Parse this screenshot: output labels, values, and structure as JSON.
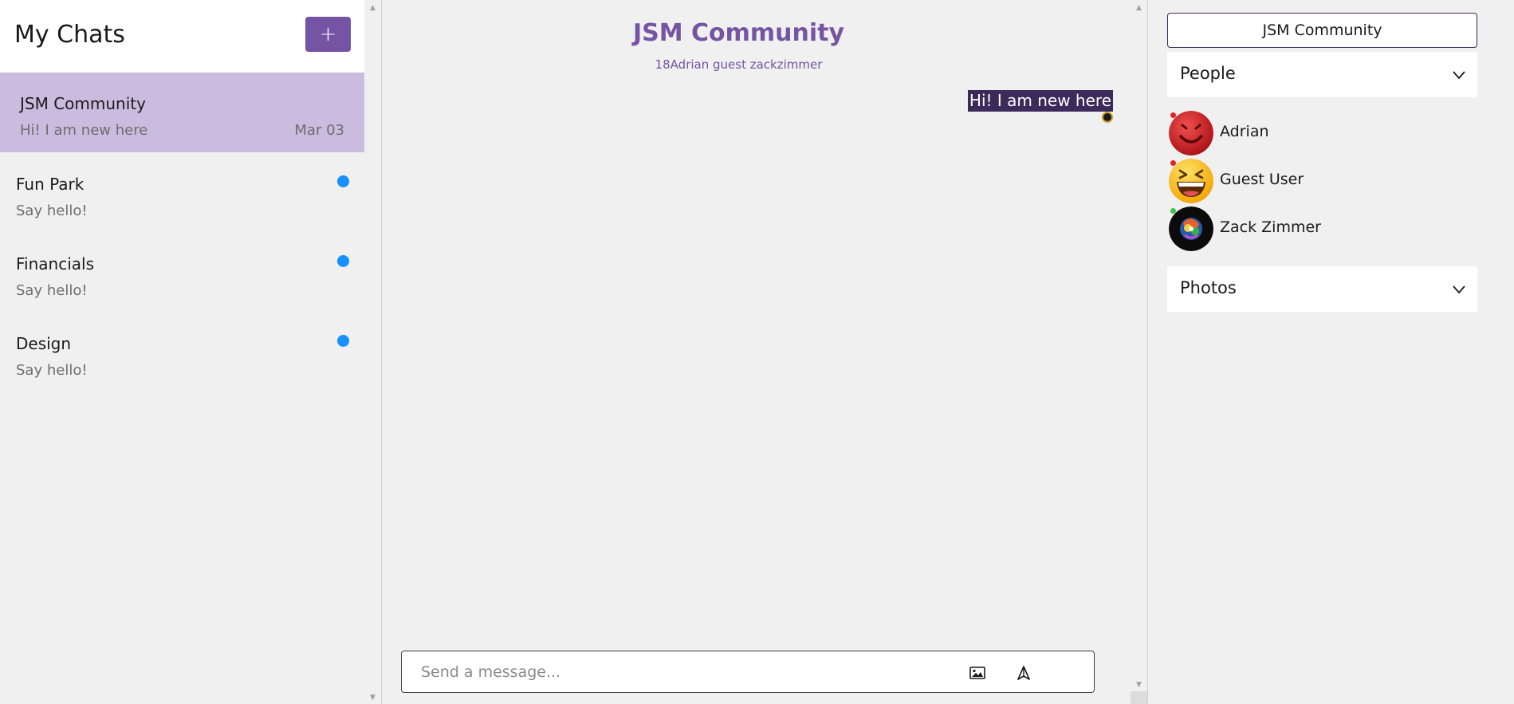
{
  "chat_list": {
    "title": "My Chats",
    "new_chat_label": "+",
    "chats": [
      {
        "title": "JSM Community",
        "preview": "Hi! I am new here",
        "date": "Mar 03",
        "active": true,
        "unread": false
      },
      {
        "title": "Fun Park",
        "preview": "Say hello!",
        "date": "",
        "active": false,
        "unread": true
      },
      {
        "title": "Financials",
        "preview": "Say hello!",
        "date": "",
        "active": false,
        "unread": true
      },
      {
        "title": "Design",
        "preview": "Say hello!",
        "date": "",
        "active": false,
        "unread": true
      }
    ]
  },
  "chat_feed": {
    "title": "JSM Community",
    "subtitle": "18Adrian guest zackzimmer",
    "messages": [
      {
        "text": "Hi! I am new here",
        "mine": true
      }
    ],
    "input": {
      "placeholder": "Send a message...",
      "value": ""
    },
    "icons": {
      "attach": "image-upload-icon",
      "send": "send-icon"
    }
  },
  "chat_settings": {
    "title": "JSM Community",
    "sections": {
      "people": "People",
      "photos": "Photos"
    },
    "people": [
      {
        "name": "Adrian",
        "avatar": "devil-emoji",
        "online": false
      },
      {
        "name": "Guest User",
        "avatar": "laughing-emoji",
        "online": false
      },
      {
        "name": "Zack Zimmer",
        "avatar": "colorful-avatar",
        "online": true
      }
    ]
  },
  "colors": {
    "accent": "#7554a3",
    "active_chat": "#cbbbdf",
    "unread": "#1890ff",
    "bubble": "#3b2a5a",
    "offline": "#e02424",
    "online": "#3ac34a"
  }
}
